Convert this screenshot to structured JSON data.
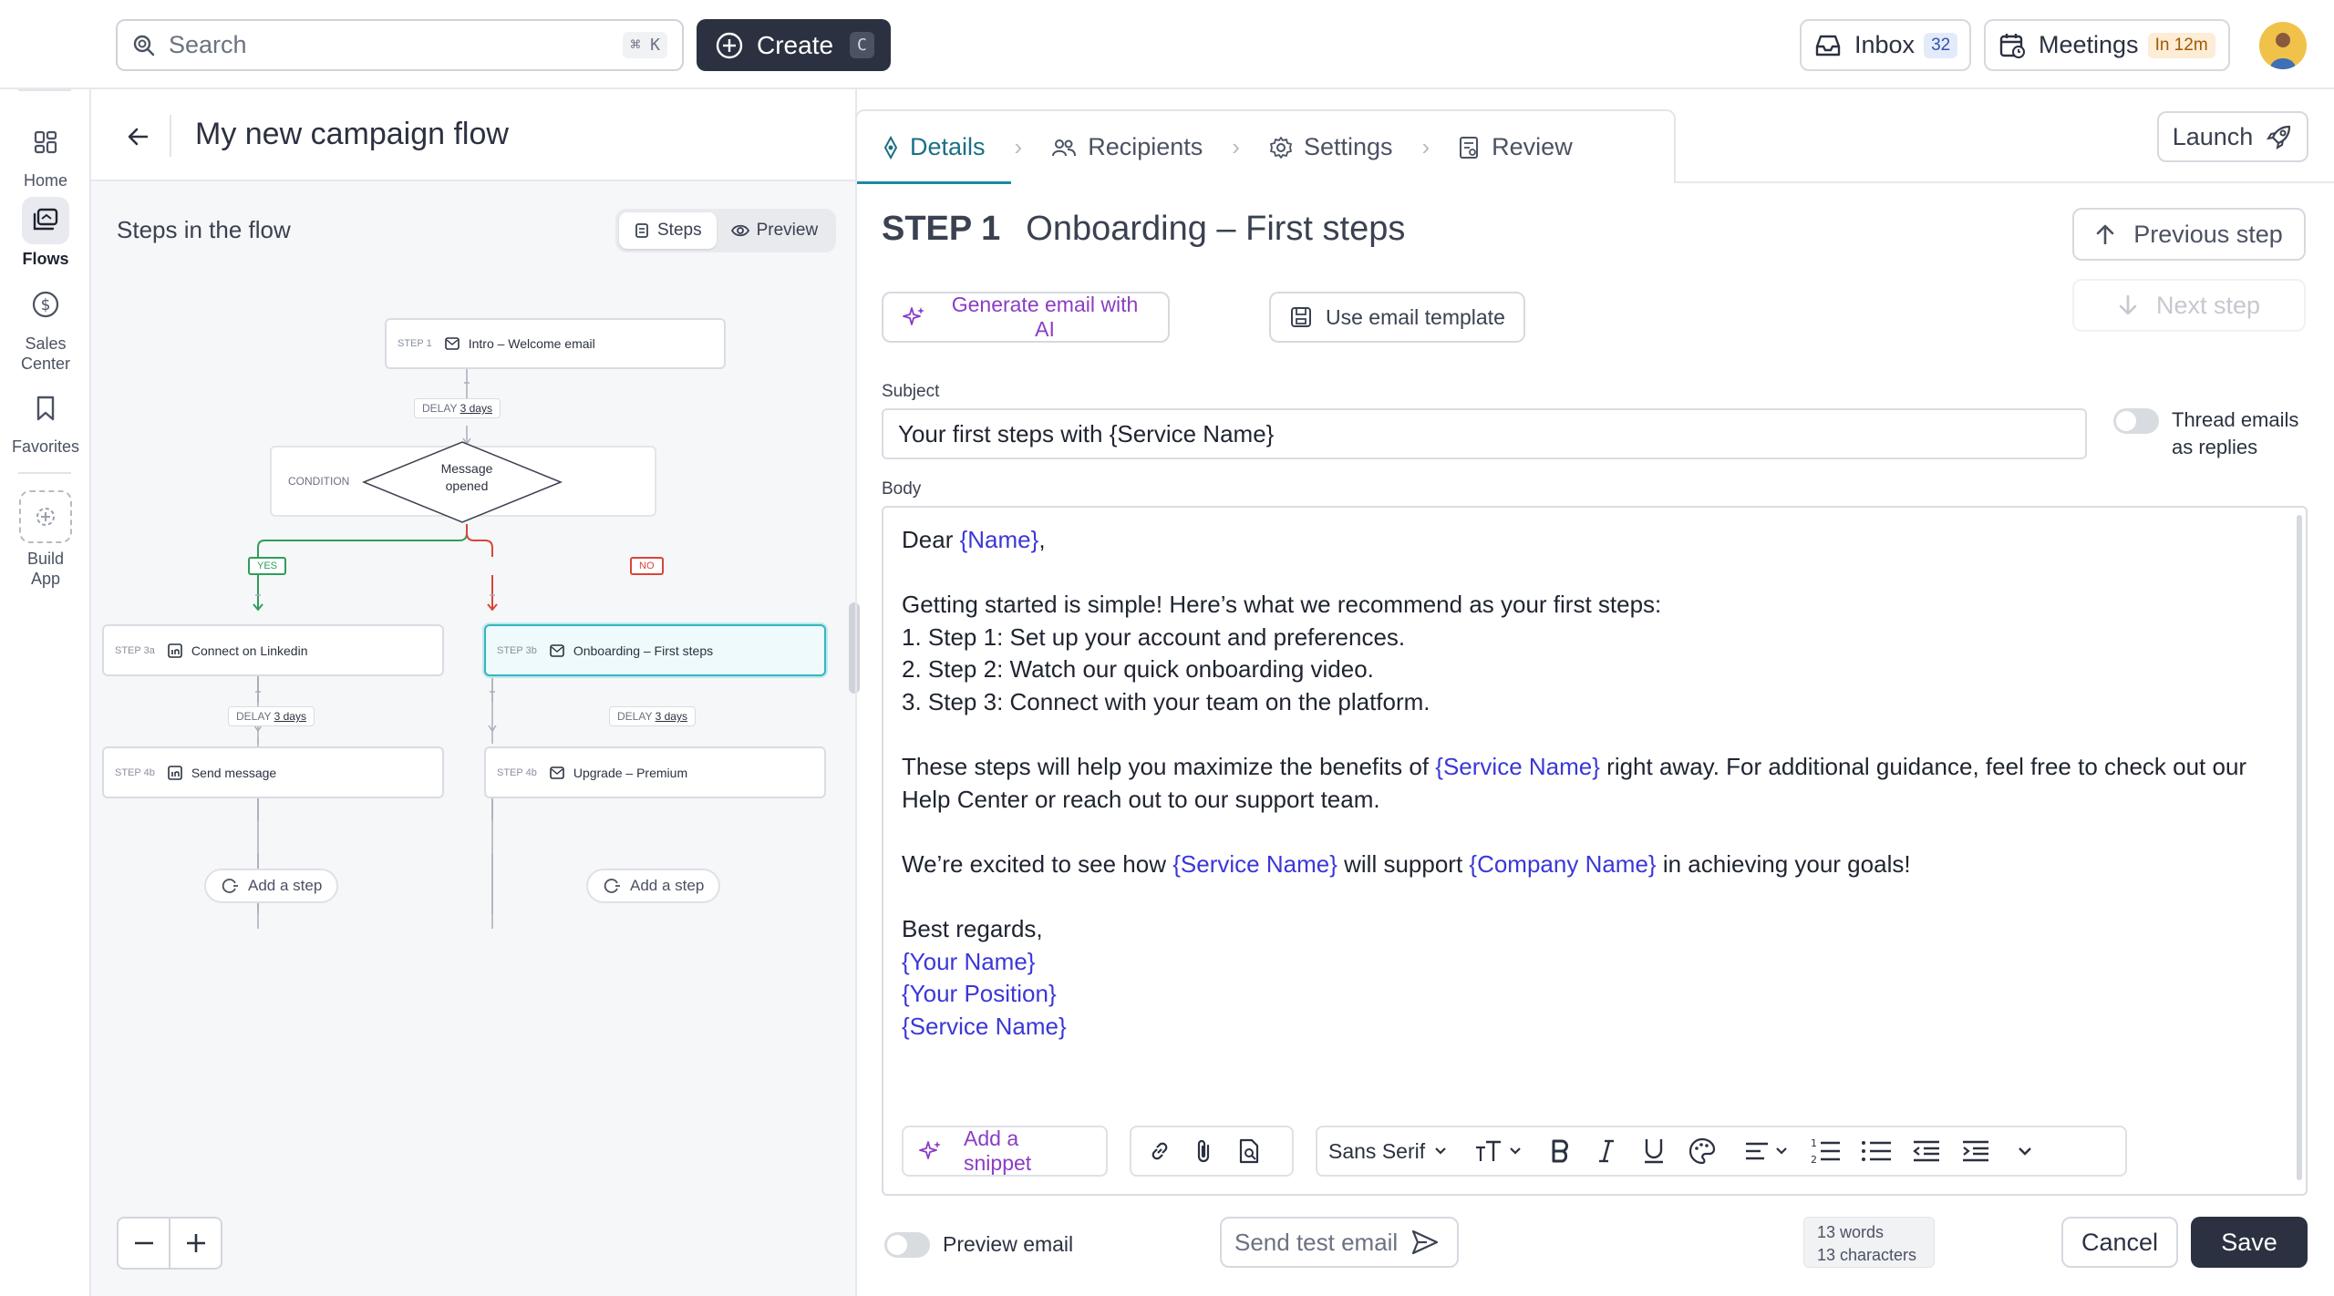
{
  "topbar": {
    "search_placeholder": "Search",
    "search_shortcut": "⌘ K",
    "create_label": "Create",
    "create_shortcut": "C",
    "inbox_label": "Inbox",
    "inbox_count": "32",
    "meetings_label": "Meetings",
    "meetings_badge": "In 12m"
  },
  "leftnav": {
    "items": [
      {
        "label": "Home",
        "icon": "home-icon"
      },
      {
        "label": "Flows",
        "icon": "flows-icon"
      },
      {
        "label": "Sales Center",
        "icon": "dollar-icon"
      },
      {
        "label": "Favorites",
        "icon": "bookmark-icon"
      },
      {
        "label": "Build App",
        "icon": "build-app-icon"
      }
    ]
  },
  "flow": {
    "title": "My new campaign flow",
    "canvas_title": "Steps in the flow",
    "view_steps": "Steps",
    "view_preview": "Preview",
    "nodes": {
      "step1_tag": "STEP 1",
      "step1_label": "Intro – Welcome email",
      "delay1_label": "DELAY",
      "delay1_value": "3 days",
      "condition_label": "CONDITION",
      "condition_text_1": "Message",
      "condition_text_2": "opened",
      "yes": "YES",
      "no": "NO",
      "step3a_tag": "STEP 3a",
      "step3a_label": "Connect on Linkedin",
      "step3b_tag": "STEP 3b",
      "step3b_label": "Onboarding – First steps",
      "delay2_label": "DELAY",
      "delay2_value": "3 days",
      "delay3_label": "DELAY",
      "delay3_value": "3 days",
      "step4b_left_tag": "STEP 4b",
      "step4b_left_label": "Send message",
      "step4b_right_tag": "STEP 4b",
      "step4b_right_label": "Upgrade – Premium",
      "add_step": "Add a step"
    }
  },
  "tabs": [
    {
      "label": "Details",
      "icon": "diamond-icon"
    },
    {
      "label": "Recipients",
      "icon": "users-icon"
    },
    {
      "label": "Settings",
      "icon": "gear-icon"
    },
    {
      "label": "Review",
      "icon": "review-icon"
    }
  ],
  "launch_label": "Launch",
  "step": {
    "number": "STEP 1",
    "name": "Onboarding – First steps",
    "prev_label": "Previous step",
    "next_label": "Next step",
    "ai_label": "Generate email with AI",
    "template_label": "Use email template",
    "subject_label": "Subject",
    "subject_value": "Your first steps with {Service Name}",
    "thread_label_1": "Thread emails",
    "thread_label_2": "as replies",
    "body_label": "Body",
    "body": {
      "l1_a": "Dear ",
      "l1_var": "{Name}",
      "l1_b": ",",
      "l2": "Getting started is simple! Here’s what we recommend as your first steps:",
      "l3": "1. Step 1: Set up your account and preferences.",
      "l4": "2. Step 2: Watch our quick onboarding video.",
      "l5": "3. Step 3: Connect with your team on the platform.",
      "l6_a": "These steps will help you maximize the benefits of ",
      "l6_var": "{Service Name}",
      "l6_b": " right away. For additional guidance, feel free to check out our",
      "l7": "Help Center or reach out to our support team.",
      "l8_a": "We’re excited to see how ",
      "l8_var1": "{Service Name}",
      "l8_b": " will support ",
      "l8_var2": "{Company Name}",
      "l8_c": " in achieving your goals!",
      "l9": "Best regards,",
      "l10": "{Your Name}",
      "l11": "{Your Position}",
      "l12": "{Service Name}"
    },
    "toolbar": {
      "snippet_label": "Add a snippet",
      "font_label": "Sans Serif"
    },
    "preview_label": "Preview email",
    "send_test_label": "Send test email",
    "words": "13 words",
    "characters": "13 characters",
    "cancel_label": "Cancel",
    "save_label": "Save"
  }
}
